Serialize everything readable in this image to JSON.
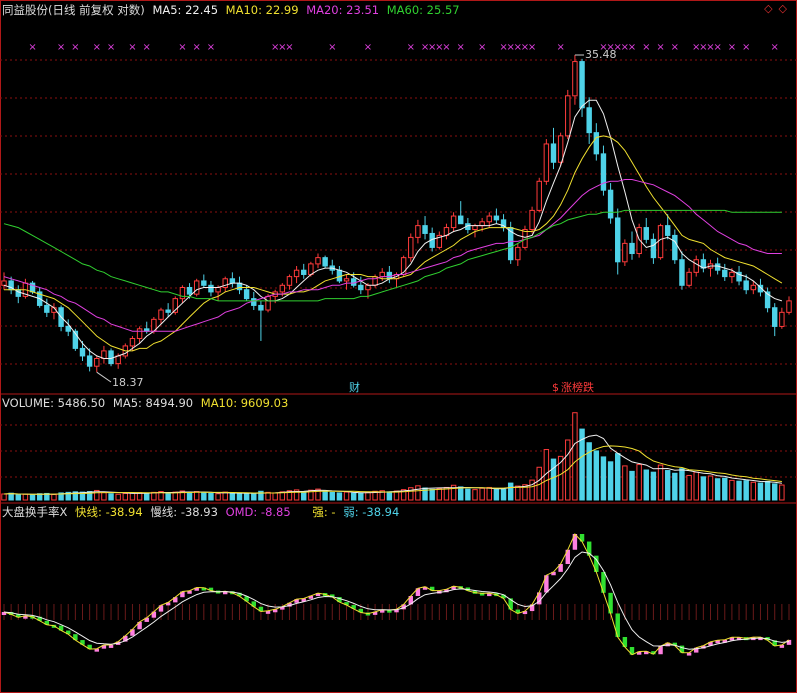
{
  "main_header": {
    "title": "同益股份(日线 前复权 对数)",
    "ma5": "MA5: 22.45",
    "ma10": "MA10: 22.99",
    "ma20": "MA20: 23.51",
    "ma60": "MA60: 25.57"
  },
  "vol_header": {
    "label": "VOLUME: 5486.50",
    "ma5": "MA5: 8494.90",
    "ma10": "MA10: 9609.03"
  },
  "ind_header": {
    "title": "大盘换手率X",
    "fast": "快线: -38.94",
    "slow": "慢线: -38.93",
    "omd": "OMD: -8.85",
    "strong": "强: -",
    "weak": "弱: -38.94"
  },
  "corner_icons": "◇◇",
  "annotations": {
    "high": "35.48",
    "low": "18.37",
    "cai": "财",
    "limit": "涨榜跌",
    "s_mark": "$"
  },
  "colors": {
    "up": "#ff3b3b",
    "down": "#4fd2e8",
    "ma5": "#f0f0f0",
    "ma10": "#f0e030",
    "ma20": "#e040e0",
    "ma60": "#30d030",
    "grid": "#8a1010",
    "ind_up": "#ff7fe0",
    "ind_down": "#30e030"
  },
  "chart_data": [
    {
      "type": "candlestick",
      "title": "同益股份(日线 前复权 对数)",
      "yscale": "log",
      "high_label": 35.48,
      "low_label": 18.37,
      "candles": [
        [
          22.0,
          22.6,
          21.8,
          22.2
        ],
        [
          22.2,
          22.4,
          21.6,
          21.8
        ],
        [
          21.8,
          22.0,
          21.2,
          21.5
        ],
        [
          21.5,
          22.3,
          21.4,
          22.1
        ],
        [
          22.1,
          22.2,
          21.6,
          21.7
        ],
        [
          21.7,
          21.9,
          21.0,
          21.1
        ],
        [
          21.1,
          21.4,
          20.6,
          20.8
        ],
        [
          20.8,
          21.2,
          20.5,
          21.0
        ],
        [
          21.0,
          21.1,
          20.0,
          20.2
        ],
        [
          20.2,
          20.5,
          19.8,
          20.0
        ],
        [
          20.0,
          20.1,
          19.2,
          19.3
        ],
        [
          19.3,
          19.6,
          18.8,
          19.0
        ],
        [
          19.0,
          19.3,
          18.4,
          18.6
        ],
        [
          18.6,
          19.0,
          18.37,
          18.9
        ],
        [
          18.9,
          19.4,
          18.7,
          19.2
        ],
        [
          19.2,
          19.3,
          18.6,
          18.7
        ],
        [
          18.7,
          19.1,
          18.5,
          19.0
        ],
        [
          19.0,
          19.5,
          18.9,
          19.4
        ],
        [
          19.4,
          19.8,
          19.2,
          19.7
        ],
        [
          19.7,
          20.2,
          19.5,
          20.1
        ],
        [
          20.1,
          20.4,
          19.9,
          20.0
        ],
        [
          20.0,
          20.6,
          19.9,
          20.5
        ],
        [
          20.5,
          21.0,
          20.3,
          20.9
        ],
        [
          20.9,
          21.2,
          20.6,
          20.8
        ],
        [
          20.8,
          21.5,
          20.7,
          21.4
        ],
        [
          21.4,
          22.0,
          21.2,
          21.9
        ],
        [
          21.9,
          22.1,
          21.4,
          21.6
        ],
        [
          21.6,
          22.3,
          21.5,
          22.2
        ],
        [
          22.2,
          22.5,
          21.9,
          22.0
        ],
        [
          22.0,
          22.2,
          21.5,
          21.7
        ],
        [
          21.7,
          22.0,
          21.3,
          21.9
        ],
        [
          21.9,
          22.4,
          21.7,
          22.3
        ],
        [
          22.3,
          22.6,
          21.9,
          22.1
        ],
        [
          22.1,
          22.4,
          21.6,
          21.8
        ],
        [
          21.8,
          22.0,
          21.3,
          21.4
        ],
        [
          21.4,
          21.7,
          20.9,
          21.1
        ],
        [
          21.1,
          21.3,
          19.6,
          20.9
        ],
        [
          20.9,
          21.6,
          20.8,
          21.5
        ],
        [
          21.5,
          21.8,
          21.2,
          21.7
        ],
        [
          21.7,
          22.1,
          21.5,
          22.0
        ],
        [
          22.0,
          22.5,
          21.8,
          22.4
        ],
        [
          22.4,
          22.9,
          22.1,
          22.7
        ],
        [
          22.7,
          23.0,
          22.3,
          22.5
        ],
        [
          22.5,
          23.1,
          22.4,
          23.0
        ],
        [
          23.0,
          23.5,
          22.8,
          23.3
        ],
        [
          23.3,
          23.4,
          22.8,
          22.9
        ],
        [
          22.9,
          23.2,
          22.5,
          22.7
        ],
        [
          22.7,
          22.9,
          22.1,
          22.2
        ],
        [
          22.2,
          22.5,
          21.8,
          22.3
        ],
        [
          22.3,
          22.6,
          21.9,
          22.0
        ],
        [
          22.0,
          22.4,
          21.6,
          21.8
        ],
        [
          21.8,
          22.1,
          21.4,
          22.0
        ],
        [
          22.0,
          22.5,
          21.9,
          22.4
        ],
        [
          22.4,
          22.8,
          22.2,
          22.6
        ],
        [
          22.6,
          22.9,
          22.1,
          22.3
        ],
        [
          22.3,
          22.6,
          21.9,
          22.5
        ],
        [
          22.5,
          23.4,
          22.4,
          23.3
        ],
        [
          23.3,
          24.5,
          23.1,
          24.3
        ],
        [
          24.3,
          25.2,
          24.0,
          24.9
        ],
        [
          24.9,
          25.4,
          24.2,
          24.5
        ],
        [
          24.5,
          24.8,
          23.6,
          23.8
        ],
        [
          23.8,
          24.6,
          23.7,
          24.4
        ],
        [
          24.4,
          25.0,
          24.2,
          24.8
        ],
        [
          24.8,
          25.6,
          24.6,
          25.4
        ],
        [
          25.4,
          26.2,
          25.1,
          25.0
        ],
        [
          25.0,
          25.3,
          24.5,
          24.7
        ],
        [
          24.7,
          25.0,
          24.3,
          24.9
        ],
        [
          24.9,
          25.3,
          24.6,
          25.1
        ],
        [
          25.1,
          25.6,
          24.8,
          25.4
        ],
        [
          25.4,
          25.8,
          25.0,
          25.2
        ],
        [
          25.2,
          25.5,
          24.6,
          24.8
        ],
        [
          24.8,
          25.1,
          23.0,
          23.2
        ],
        [
          23.2,
          24.0,
          22.9,
          23.8
        ],
        [
          23.8,
          24.9,
          23.7,
          24.7
        ],
        [
          24.7,
          25.9,
          24.5,
          25.7
        ],
        [
          25.7,
          27.5,
          25.6,
          27.3
        ],
        [
          27.3,
          29.8,
          27.1,
          29.5
        ],
        [
          29.5,
          30.5,
          28.0,
          28.4
        ],
        [
          28.4,
          30.2,
          28.2,
          30.0
        ],
        [
          30.0,
          33.0,
          29.8,
          32.6
        ],
        [
          32.6,
          35.48,
          32.0,
          35.0
        ],
        [
          35.0,
          35.2,
          31.2,
          31.8
        ],
        [
          31.8,
          32.5,
          29.5,
          30.2
        ],
        [
          30.2,
          30.8,
          28.5,
          28.9
        ],
        [
          28.9,
          29.4,
          26.5,
          26.8
        ],
        [
          26.8,
          27.2,
          25.0,
          25.3
        ],
        [
          25.3,
          25.8,
          22.5,
          23.1
        ],
        [
          23.1,
          24.2,
          22.9,
          24.0
        ],
        [
          24.0,
          24.6,
          23.2,
          23.5
        ],
        [
          23.5,
          25.0,
          23.3,
          24.8
        ],
        [
          24.8,
          25.3,
          24.0,
          24.2
        ],
        [
          24.2,
          24.5,
          23.0,
          23.3
        ],
        [
          23.3,
          25.0,
          23.2,
          24.9
        ],
        [
          24.9,
          25.5,
          24.2,
          24.4
        ],
        [
          24.4,
          24.7,
          23.0,
          23.2
        ],
        [
          23.2,
          23.6,
          21.8,
          22.0
        ],
        [
          22.0,
          22.8,
          21.9,
          22.6
        ],
        [
          22.6,
          23.4,
          22.4,
          23.2
        ],
        [
          23.2,
          23.5,
          22.6,
          22.8
        ],
        [
          22.8,
          23.2,
          22.4,
          23.0
        ],
        [
          23.0,
          23.3,
          22.5,
          22.7
        ],
        [
          22.7,
          23.0,
          22.2,
          22.4
        ],
        [
          22.4,
          22.8,
          22.1,
          22.6
        ],
        [
          22.6,
          22.9,
          22.0,
          22.2
        ],
        [
          22.2,
          22.5,
          21.6,
          21.8
        ],
        [
          21.8,
          22.2,
          21.6,
          22.0
        ],
        [
          22.0,
          22.3,
          21.5,
          21.7
        ],
        [
          21.7,
          21.9,
          20.8,
          21.0
        ],
        [
          21.0,
          21.2,
          19.8,
          20.2
        ],
        [
          20.2,
          21.0,
          20.1,
          20.8
        ],
        [
          20.8,
          21.5,
          20.7,
          21.3
        ]
      ],
      "ma_lines": {
        "MA5": [
          22.0,
          21.9,
          21.7,
          21.6,
          21.5,
          21.4,
          21.2,
          21.0,
          20.6,
          20.3,
          19.9,
          19.5,
          19.2,
          19.0,
          18.9,
          18.9,
          19.0,
          19.1,
          19.3,
          19.5,
          19.8,
          20.0,
          20.3,
          20.6,
          20.9,
          21.2,
          21.5,
          21.8,
          21.9,
          21.9,
          21.9,
          22.0,
          22.1,
          22.1,
          22.0,
          21.8,
          21.5,
          21.3,
          21.3,
          21.4,
          21.6,
          21.9,
          22.2,
          22.5,
          22.7,
          22.8,
          22.8,
          22.7,
          22.6,
          22.4,
          22.2,
          22.0,
          22.0,
          22.1,
          22.3,
          22.4,
          22.6,
          23.0,
          23.6,
          24.0,
          24.2,
          24.3,
          24.4,
          24.6,
          24.7,
          24.9,
          24.9,
          24.9,
          24.9,
          25.0,
          24.9,
          24.6,
          24.4,
          24.3,
          24.4,
          25.1,
          26.2,
          27.2,
          28.2,
          29.6,
          31.2,
          31.9,
          32.3,
          32.3,
          31.4,
          29.9,
          28.2,
          26.7,
          25.2,
          24.2,
          23.8,
          23.9,
          24.2,
          24.3,
          24.1,
          23.5,
          23.2,
          23.0,
          22.8,
          22.9,
          22.9,
          22.8,
          22.7,
          22.5,
          22.4,
          22.2,
          21.9,
          21.6,
          21.4,
          21.3
        ],
        "MA10": [
          21.8,
          21.8,
          21.8,
          21.8,
          21.7,
          21.6,
          21.5,
          21.4,
          21.2,
          21.0,
          20.7,
          20.4,
          20.1,
          19.8,
          19.6,
          19.4,
          19.3,
          19.2,
          19.2,
          19.3,
          19.3,
          19.5,
          19.6,
          19.8,
          20.0,
          20.3,
          20.6,
          20.9,
          21.2,
          21.4,
          21.5,
          21.7,
          21.8,
          21.9,
          21.9,
          21.9,
          21.8,
          21.7,
          21.6,
          21.6,
          21.6,
          21.7,
          21.7,
          21.8,
          22.0,
          22.2,
          22.3,
          22.4,
          22.5,
          22.5,
          22.5,
          22.4,
          22.4,
          22.3,
          22.3,
          22.3,
          22.4,
          22.5,
          22.8,
          23.1,
          23.3,
          23.5,
          23.7,
          23.9,
          24.2,
          24.4,
          24.6,
          24.7,
          24.8,
          24.8,
          24.8,
          24.8,
          24.7,
          24.6,
          24.6,
          24.7,
          25.0,
          25.4,
          26.0,
          26.8,
          27.8,
          28.6,
          29.3,
          29.9,
          30.0,
          29.9,
          29.6,
          29.1,
          28.4,
          27.7,
          27.0,
          26.4,
          25.9,
          25.4,
          24.9,
          24.4,
          24.2,
          24.1,
          24.0,
          23.7,
          23.5,
          23.3,
          23.2,
          23.1,
          23.0,
          22.9,
          22.7,
          22.5,
          22.3,
          22.1
        ],
        "MA20": [
          22.4,
          22.3,
          22.2,
          22.1,
          22.0,
          21.9,
          21.8,
          21.6,
          21.5,
          21.3,
          21.2,
          21.0,
          20.8,
          20.6,
          20.5,
          20.3,
          20.2,
          20.1,
          20.0,
          20.0,
          20.0,
          20.0,
          20.0,
          20.0,
          20.0,
          20.1,
          20.2,
          20.3,
          20.4,
          20.5,
          20.6,
          20.8,
          20.9,
          21.0,
          21.2,
          21.3,
          21.4,
          21.5,
          21.6,
          21.6,
          21.7,
          21.7,
          21.8,
          21.8,
          21.8,
          21.9,
          22.0,
          22.0,
          22.1,
          22.1,
          22.2,
          22.3,
          22.3,
          22.4,
          22.4,
          22.5,
          22.5,
          22.6,
          22.7,
          22.8,
          22.9,
          23.0,
          23.1,
          23.3,
          23.4,
          23.6,
          23.7,
          23.8,
          23.9,
          24.0,
          24.0,
          24.1,
          24.1,
          24.2,
          24.3,
          24.4,
          24.7,
          25.0,
          25.3,
          25.7,
          26.1,
          26.5,
          26.8,
          27.0,
          27.2,
          27.3,
          27.3,
          27.4,
          27.4,
          27.3,
          27.2,
          27.1,
          26.9,
          26.7,
          26.5,
          26.2,
          25.9,
          25.5,
          25.2,
          24.9,
          24.6,
          24.4,
          24.2,
          24.0,
          23.9,
          23.7,
          23.6,
          23.5,
          23.5,
          23.5
        ],
        "MA60": [
          25.0,
          24.9,
          24.8,
          24.6,
          24.4,
          24.2,
          24.0,
          23.8,
          23.6,
          23.4,
          23.2,
          23.0,
          22.9,
          22.7,
          22.6,
          22.4,
          22.3,
          22.2,
          22.1,
          22.0,
          21.9,
          21.8,
          21.7,
          21.7,
          21.6,
          21.5,
          21.5,
          21.4,
          21.4,
          21.4,
          21.3,
          21.3,
          21.3,
          21.3,
          21.3,
          21.3,
          21.3,
          21.3,
          21.3,
          21.3,
          21.3,
          21.3,
          21.3,
          21.3,
          21.3,
          21.4,
          21.4,
          21.4,
          21.4,
          21.4,
          21.5,
          21.5,
          21.6,
          21.7,
          21.8,
          21.9,
          22.0,
          22.1,
          22.2,
          22.4,
          22.5,
          22.6,
          22.8,
          22.9,
          23.0,
          23.2,
          23.3,
          23.4,
          23.5,
          23.6,
          23.7,
          23.8,
          24.0,
          24.2,
          24.3,
          24.5,
          24.7,
          24.9,
          25.0,
          25.2,
          25.3,
          25.4,
          25.5,
          25.5,
          25.6,
          25.6,
          25.6,
          25.7,
          25.7,
          25.7,
          25.7,
          25.7,
          25.7,
          25.7,
          25.7,
          25.7,
          25.7,
          25.7,
          25.7,
          25.7,
          25.7,
          25.7,
          25.6,
          25.6,
          25.6,
          25.6,
          25.6,
          25.6,
          25.6,
          25.6
        ]
      },
      "signal_marks": [
        4,
        8,
        10,
        13,
        15,
        18,
        20,
        25,
        27,
        29,
        38,
        39,
        40,
        46,
        51,
        57,
        59,
        60,
        61,
        62,
        64,
        67,
        70,
        71,
        72,
        73,
        74,
        78,
        84,
        85,
        86,
        87,
        88,
        90,
        92,
        94,
        97,
        98,
        99,
        100,
        102,
        104,
        108
      ]
    },
    {
      "type": "bar",
      "title": "VOLUME",
      "values": [
        2200,
        2500,
        1900,
        2100,
        1800,
        2300,
        2400,
        2000,
        2600,
        2800,
        3000,
        2900,
        3100,
        3500,
        2700,
        2300,
        2100,
        2400,
        2600,
        2700,
        2500,
        2800,
        3100,
        2600,
        2900,
        3300,
        2700,
        3100,
        2600,
        2400,
        2300,
        2900,
        2600,
        2400,
        2200,
        2300,
        3200,
        2800,
        2600,
        3000,
        3400,
        3700,
        3100,
        3600,
        4000,
        3200,
        2800,
        2600,
        2900,
        2500,
        2400,
        2800,
        3200,
        3400,
        3000,
        3300,
        3800,
        4500,
        5200,
        4400,
        3900,
        4200,
        4600,
        5400,
        4800,
        4000,
        3800,
        4300,
        4600,
        4100,
        3900,
        6200,
        5100,
        5600,
        7300,
        12000,
        18500,
        15000,
        16000,
        22000,
        32000,
        26000,
        21000,
        18000,
        15800,
        14000,
        17000,
        12500,
        10500,
        13000,
        11000,
        10200,
        12800,
        10800,
        9800,
        11500,
        9000,
        10200,
        8500,
        8800,
        7800,
        8000,
        7200,
        6900,
        7100,
        6500,
        6200,
        6800,
        5900,
        5486.5
      ],
      "ma5_last": 8494.9,
      "ma10_last": 9609.03
    },
    {
      "type": "bar",
      "title": "大盘换手率X",
      "fast_last": -38.94,
      "slow_last": -38.93,
      "omd_last": -8.85,
      "weak_last": -38.94
    }
  ]
}
